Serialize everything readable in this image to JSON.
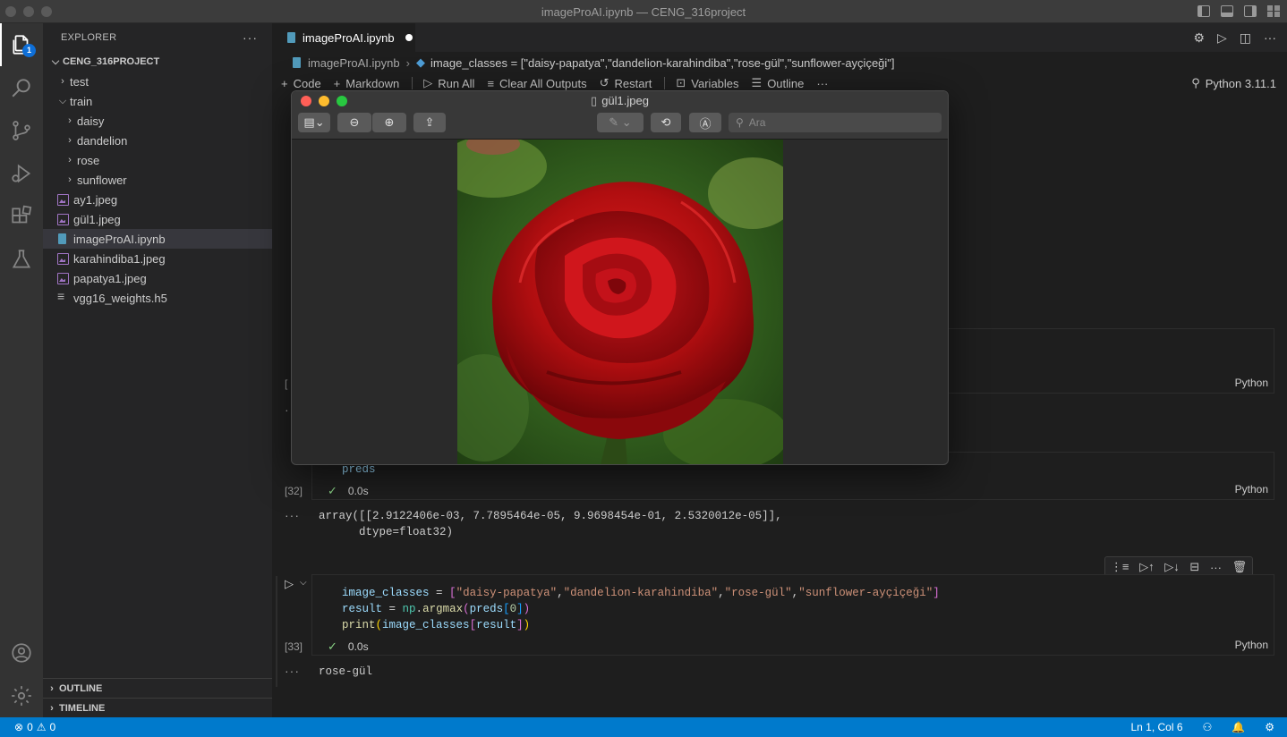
{
  "window": {
    "title": "imageProAI.ipynb — CENG_316project"
  },
  "activity_bar": {
    "explorer_badge": "1"
  },
  "sidebar": {
    "header": "EXPLORER",
    "project": "CENG_316PROJECT",
    "items": [
      {
        "label": "test"
      },
      {
        "label": "train"
      },
      {
        "label": "daisy"
      },
      {
        "label": "dandelion"
      },
      {
        "label": "rose"
      },
      {
        "label": "sunflower"
      },
      {
        "label": "ay1.jpeg"
      },
      {
        "label": "gül1.jpeg"
      },
      {
        "label": "imageProAI.ipynb"
      },
      {
        "label": "karahindiba1.jpeg"
      },
      {
        "label": "papatya1.jpeg"
      },
      {
        "label": "vgg16_weights.h5"
      }
    ],
    "outline": "OUTLINE",
    "timeline": "TIMELINE"
  },
  "editor": {
    "tab": "imageProAI.ipynb",
    "breadcrumb": {
      "file": "imageProAI.ipynb",
      "symbol": "image_classes = [\"daisy-papatya\",\"dandelion-karahindiba\",\"rose-gül\",\"sunflower-ayçiçeği\"]"
    },
    "toolbar": {
      "code": "Code",
      "markdown": "Markdown",
      "run_all": "Run All",
      "clear_outputs": "Clear All Outputs",
      "restart": "Restart",
      "variables": "Variables",
      "outline": "Outline",
      "kernel": "Python 3.11.1"
    },
    "cells": {
      "cell_a": {
        "bracket": "[",
        "lang": "Python"
      },
      "cell_b": {
        "code": "preds",
        "exec": "[32]",
        "time": "0.0s",
        "lang": "Python",
        "output_line1": "array([[2.9122406e-03, 7.7895464e-05, 9.9698454e-01, 2.5320012e-05]],",
        "output_line2": "      dtype=float32)"
      },
      "cell_c": {
        "line1_var": "image_classes",
        "line1_s1": "\"daisy-papatya\"",
        "line1_s2": "\"dandelion-karahindiba\"",
        "line1_s3": "\"rose-gül\"",
        "line1_s4": "\"sunflower-ayçiçeği\"",
        "line2_var": "result",
        "line2_mod": "np",
        "line2_fn": "argmax",
        "line2_arg": "preds",
        "line2_idx": "0",
        "line3_fn": "print",
        "line3_var": "image_classes",
        "line3_arg": "result",
        "exec": "[33]",
        "time": "0.0s",
        "lang": "Python",
        "output": "rose-gül"
      }
    }
  },
  "preview": {
    "title": "gül1.jpeg",
    "search_placeholder": "Ara"
  },
  "statusbar": {
    "errors": "0",
    "warnings": "0",
    "position": "Ln 1, Col 6"
  }
}
